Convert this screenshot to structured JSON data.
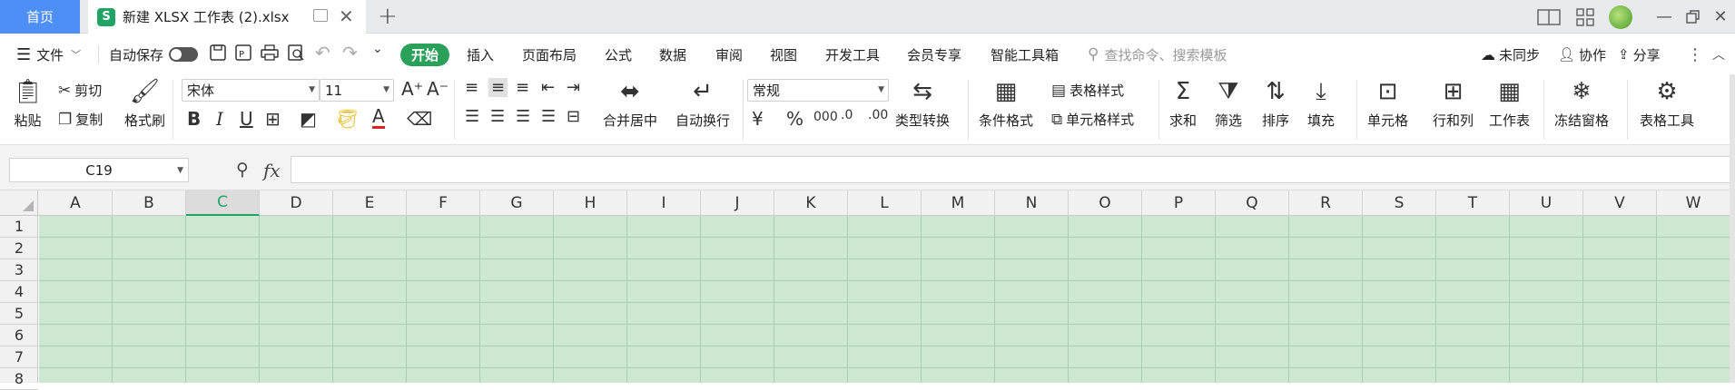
{
  "tabs": {
    "home": "首页",
    "doc_icon": "S",
    "doc_title": "新建 XLSX 工作表 (2).xlsx",
    "new_tab": "+"
  },
  "menu": {
    "file": "文件",
    "autosave": "自动保存",
    "tabs": [
      "开始",
      "插入",
      "页面布局",
      "公式",
      "数据",
      "审阅",
      "视图",
      "开发工具",
      "会员专享",
      "智能工具箱"
    ],
    "search_placeholder": "查找命令、搜索模板",
    "sync": "未同步",
    "collab": "协作",
    "share": "分享"
  },
  "ribbon": {
    "paste": "粘贴",
    "cut": "剪切",
    "copy": "复制",
    "format_painter": "格式刷",
    "font_name": "宋体",
    "font_size": "11",
    "merge_center": "合并居中",
    "wrap_text": "自动换行",
    "number_format": "常规",
    "type_convert": "类型转换",
    "conditional_format": "条件格式",
    "table_style": "表格样式",
    "cell_style": "单元格样式",
    "sum": "求和",
    "filter": "筛选",
    "sort": "排序",
    "fill": "填充",
    "cell": "单元格",
    "row_col": "行和列",
    "worksheet": "工作表",
    "freeze": "冻结窗格",
    "table_tools": "表格工具"
  },
  "formula_bar": {
    "cell_ref": "C19",
    "fx": "fx",
    "formula": ""
  },
  "grid": {
    "columns": [
      "A",
      "B",
      "C",
      "D",
      "E",
      "F",
      "G",
      "H",
      "I",
      "J",
      "K",
      "L",
      "M",
      "N",
      "O",
      "P",
      "Q",
      "R",
      "S",
      "T",
      "U",
      "V",
      "W"
    ],
    "selected_column": "C",
    "rows": [
      "1",
      "2",
      "3",
      "4",
      "5",
      "6",
      "7",
      "8"
    ]
  },
  "colors": {
    "home_tab": "#4e8ef7",
    "accent_green": "#2aa05a",
    "cell_fill": "#cde7d1"
  }
}
